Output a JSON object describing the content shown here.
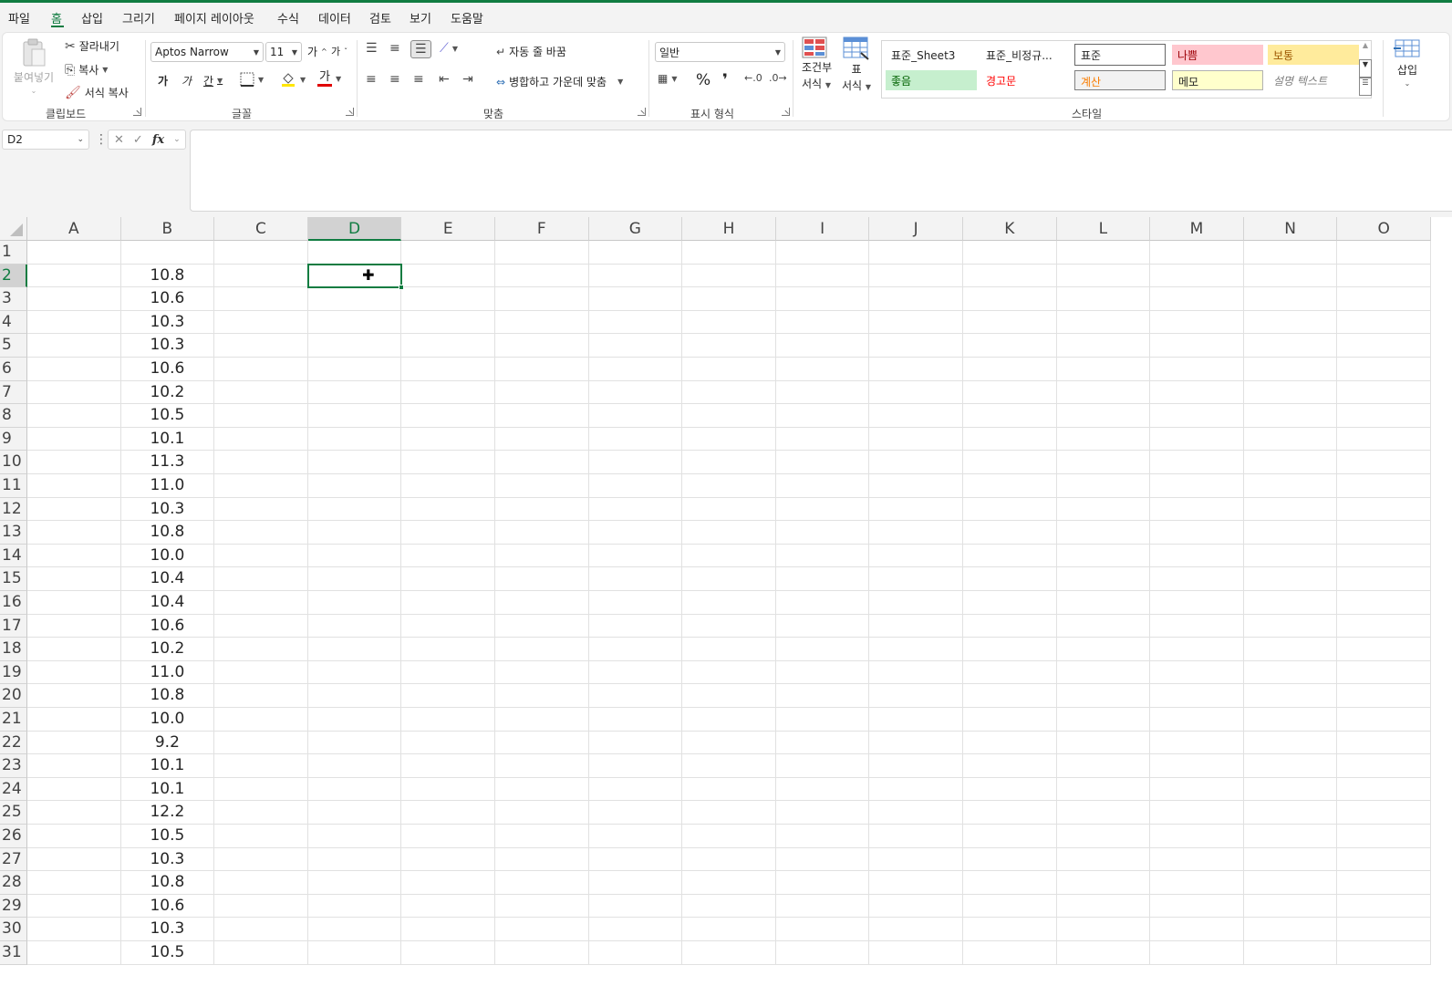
{
  "menu": [
    "파일",
    "홈",
    "삽입",
    "그리기",
    "페이지 레이아웃",
    "수식",
    "데이터",
    "검토",
    "보기",
    "도움말"
  ],
  "clipboard": {
    "paste": "붙여넣기",
    "cut": "잘라내기",
    "copy": "복사",
    "format_painter": "서식 복사",
    "label": "클립보드"
  },
  "font": {
    "name": "Aptos Narrow",
    "size": "11",
    "grow": "가",
    "shrink": "가",
    "bold": "가",
    "italic": "가",
    "underline": "간",
    "font_color_glyph": "가",
    "label": "글꼴"
  },
  "alignment": {
    "wrap": "자동 줄 바꿈",
    "merge": "병합하고 가운데 맞춤",
    "label": "맞춤"
  },
  "number": {
    "format": "일반",
    "percent": "%",
    "comma": "❜",
    "label": "표시 형식"
  },
  "styles_group": {
    "conditional": [
      "조건부",
      "서식"
    ],
    "table": [
      "표",
      "서식"
    ],
    "label": "스타일",
    "items": [
      {
        "label": "표준_Sheet3"
      },
      {
        "label": "표준_비정규..."
      },
      {
        "label": "표준"
      },
      {
        "label": "나쁨"
      },
      {
        "label": "보통"
      },
      {
        "label": "좋음"
      },
      {
        "label": "경고문"
      },
      {
        "label": "계산"
      },
      {
        "label": "메모"
      },
      {
        "label": "설명 텍스트"
      }
    ]
  },
  "cells_group": {
    "insert": "삽입"
  },
  "formula_bar": {
    "name_box": "D2",
    "fx": "fx",
    "value": ""
  },
  "columns": [
    "A",
    "B",
    "C",
    "D",
    "E",
    "F",
    "G",
    "H",
    "I",
    "J",
    "K",
    "L",
    "M",
    "N",
    "O"
  ],
  "rows": [
    "1",
    "2",
    "3",
    "4",
    "5",
    "6",
    "7",
    "8",
    "9",
    "10",
    "11",
    "12",
    "13",
    "14",
    "15",
    "16",
    "17",
    "18",
    "19",
    "20",
    "21",
    "22",
    "23",
    "24",
    "25",
    "26",
    "27",
    "28",
    "29",
    "30",
    "31"
  ],
  "column_b_values": [
    "",
    "10.8",
    "10.6",
    "10.3",
    "10.3",
    "10.6",
    "10.2",
    "10.5",
    "10.1",
    "11.3",
    "11.0",
    "10.3",
    "10.8",
    "10.0",
    "10.4",
    "10.4",
    "10.6",
    "10.2",
    "11.0",
    "10.8",
    "10.0",
    "9.2",
    "10.1",
    "10.1",
    "12.2",
    "10.5",
    "10.3",
    "10.8",
    "10.6",
    "10.3",
    "10.5"
  ],
  "selected_cell": "D2",
  "colors": {
    "accent": "#107c41",
    "bad_bg": "#ffc7ce",
    "bad_fg": "#9c0006",
    "neutral_bg": "#ffeb9c",
    "neutral_fg": "#9c5700",
    "good_bg": "#c6efce",
    "good_fg": "#006100",
    "warning_fg": "#ff0000",
    "calc_fg": "#fa7d00",
    "note_bg": "#ffffcc"
  }
}
